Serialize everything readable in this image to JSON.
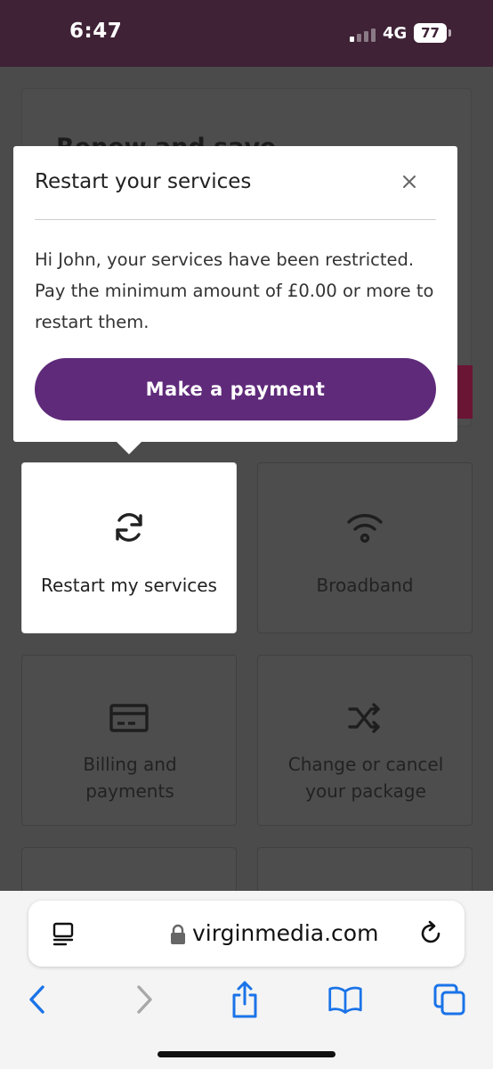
{
  "status_bar": {
    "time": "6:47",
    "network": "4G",
    "battery": "77"
  },
  "promo": {
    "title": "Renew and save"
  },
  "popover": {
    "title": "Restart your services",
    "body": "Hi John, your services have been restricted. Pay the minimum amount of £0.00 or more to restart them.",
    "button_label": "Make a payment"
  },
  "tiles": [
    {
      "label": "Restart my services",
      "icon": "refresh-icon"
    },
    {
      "label": "Broadband",
      "icon": "wifi-icon"
    },
    {
      "label": "Billing and payments",
      "icon": "credit-card-icon"
    },
    {
      "label": "Change or cancel your package",
      "icon": "shuffle-icon"
    }
  ],
  "browser": {
    "url": "virginmedia.com"
  },
  "colors": {
    "status_bar": "#3f2236",
    "accent": "#5f2a7a",
    "overlay": "#4b4b4b"
  }
}
